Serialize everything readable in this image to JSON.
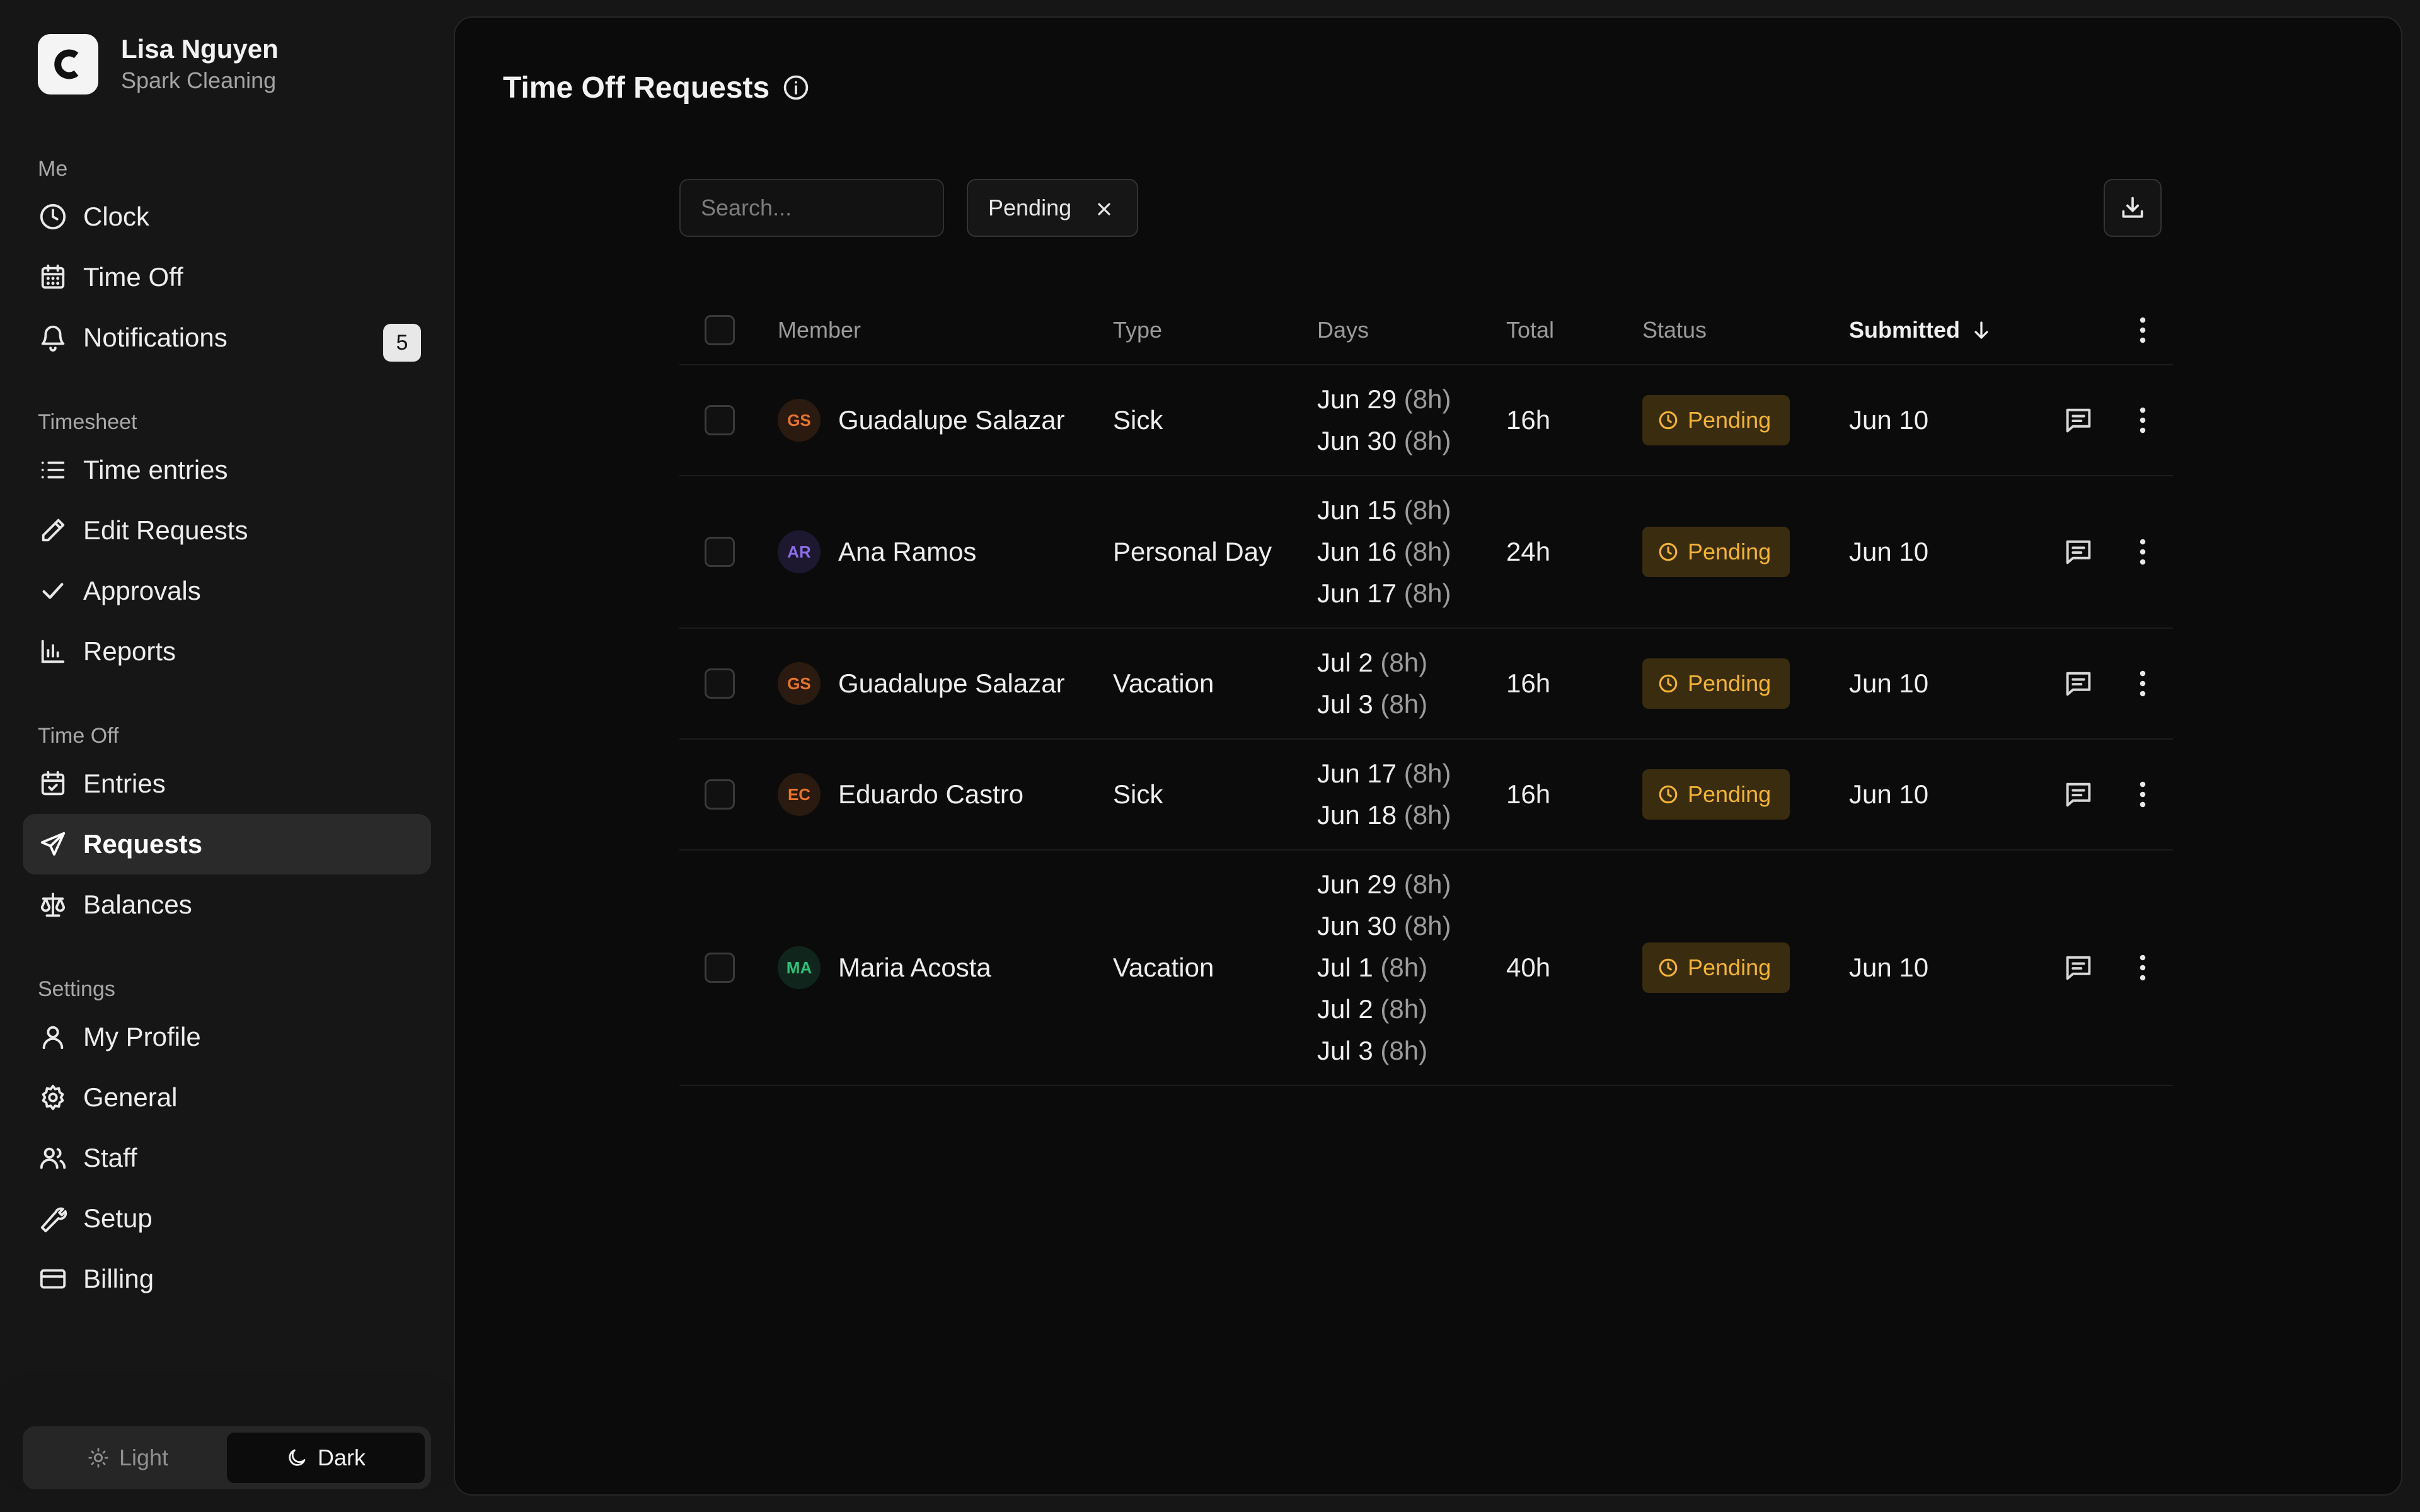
{
  "account": {
    "name": "Lisa Nguyen",
    "org": "Spark Cleaning",
    "logo_letter": "C"
  },
  "sidebar": {
    "sections": [
      {
        "label": "Me",
        "items": [
          {
            "label": "Clock",
            "icon": "clock-icon"
          },
          {
            "label": "Time Off",
            "icon": "calendar-icon"
          },
          {
            "label": "Notifications",
            "icon": "bell-icon",
            "badge": "5"
          }
        ]
      },
      {
        "label": "Timesheet",
        "items": [
          {
            "label": "Time entries",
            "icon": "list-icon"
          },
          {
            "label": "Edit Requests",
            "icon": "pencil-icon"
          },
          {
            "label": "Approvals",
            "icon": "check-icon"
          },
          {
            "label": "Reports",
            "icon": "bar-chart-icon"
          }
        ]
      },
      {
        "label": "Time Off",
        "items": [
          {
            "label": "Entries",
            "icon": "calendar-check-icon"
          },
          {
            "label": "Requests",
            "icon": "send-icon",
            "active": true
          },
          {
            "label": "Balances",
            "icon": "scale-icon"
          }
        ]
      },
      {
        "label": "Settings",
        "items": [
          {
            "label": "My Profile",
            "icon": "user-icon"
          },
          {
            "label": "General",
            "icon": "gear-icon"
          },
          {
            "label": "Staff",
            "icon": "users-icon"
          },
          {
            "label": "Setup",
            "icon": "wrench-icon"
          },
          {
            "label": "Billing",
            "icon": "credit-card-icon"
          }
        ]
      }
    ],
    "theme": {
      "light_label": "Light",
      "dark_label": "Dark",
      "selected": "Dark"
    }
  },
  "page": {
    "title": "Time Off Requests",
    "search_placeholder": "Search...",
    "filter_chip": "Pending"
  },
  "table": {
    "columns": {
      "member": "Member",
      "type": "Type",
      "days": "Days",
      "total": "Total",
      "status": "Status",
      "submitted": "Submitted"
    },
    "rows": [
      {
        "initials": "GS",
        "avatar_color": "#e8742c",
        "avatar_bg": "#2a1a10",
        "member": "Guadalupe Salazar",
        "type": "Sick",
        "days": [
          {
            "date": "Jun 29",
            "hours": "(8h)"
          },
          {
            "date": "Jun 30",
            "hours": "(8h)"
          }
        ],
        "total": "16h",
        "status": "Pending",
        "submitted": "Jun 10"
      },
      {
        "initials": "AR",
        "avatar_color": "#8b6ee6",
        "avatar_bg": "#1d1830",
        "member": "Ana Ramos",
        "type": "Personal Day",
        "days": [
          {
            "date": "Jun 15",
            "hours": "(8h)"
          },
          {
            "date": "Jun 16",
            "hours": "(8h)"
          },
          {
            "date": "Jun 17",
            "hours": "(8h)"
          }
        ],
        "total": "24h",
        "status": "Pending",
        "submitted": "Jun 10"
      },
      {
        "initials": "GS",
        "avatar_color": "#e8742c",
        "avatar_bg": "#2a1a10",
        "member": "Guadalupe Salazar",
        "type": "Vacation",
        "days": [
          {
            "date": "Jul 2",
            "hours": "(8h)"
          },
          {
            "date": "Jul 3",
            "hours": "(8h)"
          }
        ],
        "total": "16h",
        "status": "Pending",
        "submitted": "Jun 10"
      },
      {
        "initials": "EC",
        "avatar_color": "#e8742c",
        "avatar_bg": "#2a1a10",
        "member": "Eduardo Castro",
        "type": "Sick",
        "days": [
          {
            "date": "Jun 17",
            "hours": "(8h)"
          },
          {
            "date": "Jun 18",
            "hours": "(8h)"
          }
        ],
        "total": "16h",
        "status": "Pending",
        "submitted": "Jun 10"
      },
      {
        "initials": "MA",
        "avatar_color": "#2fbf7a",
        "avatar_bg": "#10261c",
        "member": "Maria Acosta",
        "type": "Vacation",
        "days": [
          {
            "date": "Jun 29",
            "hours": "(8h)"
          },
          {
            "date": "Jun 30",
            "hours": "(8h)"
          },
          {
            "date": "Jul 1",
            "hours": "(8h)"
          },
          {
            "date": "Jul 2",
            "hours": "(8h)"
          },
          {
            "date": "Jul 3",
            "hours": "(8h)"
          }
        ],
        "total": "40h",
        "status": "Pending",
        "submitted": "Jun 10"
      }
    ]
  },
  "colors": {
    "pending_text": "#f3b336",
    "pending_bg": "#3a2c0f",
    "panel_bg": "#0b0b0b",
    "sidebar_bg": "#161616"
  }
}
